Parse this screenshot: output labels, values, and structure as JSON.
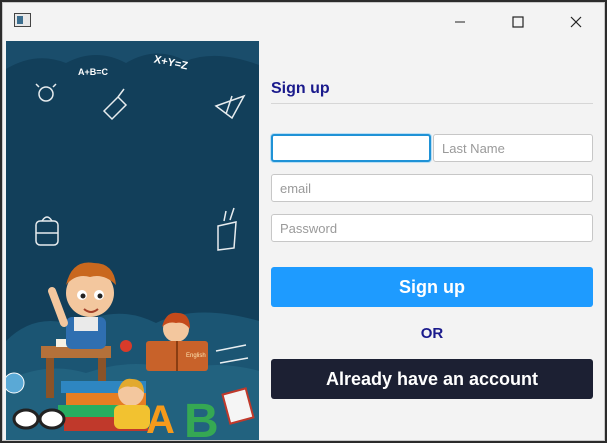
{
  "window": {
    "controls": [
      "minimize-icon",
      "maximize-icon",
      "close-icon"
    ]
  },
  "form": {
    "heading": "Sign up",
    "first_name": {
      "value": "",
      "placeholder": ""
    },
    "last_name": {
      "value": "",
      "placeholder": "Last Name"
    },
    "email": {
      "value": "",
      "placeholder": "email"
    },
    "password": {
      "value": "",
      "placeholder": "Password"
    },
    "signup_label": "Sign up",
    "or_label": "OR",
    "account_label": "Already have an account"
  },
  "illustration": {
    "formulas": [
      "A+B=C",
      "X+Y=Z"
    ],
    "book_title": "English",
    "letters": [
      "A",
      "B"
    ]
  },
  "colors": {
    "accent": "#1e9bff",
    "heading": "#1a1a8c",
    "dark_button": "#1c2033",
    "panel_bg": "#123f5a"
  }
}
